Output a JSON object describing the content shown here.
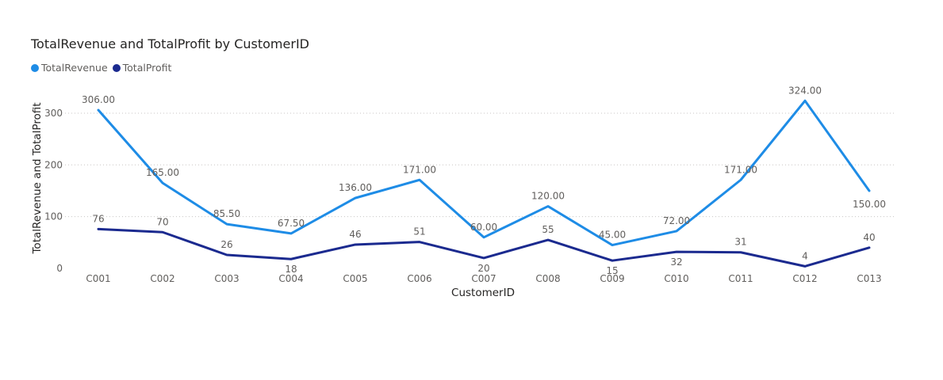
{
  "chart_data": {
    "type": "line",
    "title": "TotalRevenue and TotalProfit by CustomerID",
    "xlabel": "CustomerID",
    "ylabel": "TotalRevenue and TotalProfit",
    "ylim": [
      0,
      330
    ],
    "yticks": [
      0,
      100,
      200,
      300
    ],
    "grid": "horizontal dotted",
    "legend": "top-left",
    "categories": [
      "C001",
      "C002",
      "C003",
      "C004",
      "C005",
      "C006",
      "C007",
      "C008",
      "C009",
      "C010",
      "C011",
      "C012",
      "C013"
    ],
    "series": [
      {
        "name": "TotalRevenue",
        "color": "#1e8ce6",
        "values": [
          306,
          165,
          85.5,
          67.5,
          136,
          171,
          60,
          120,
          45,
          72,
          171,
          324,
          150
        ],
        "labels": [
          "306.00",
          "165.00",
          "85.50",
          "67.50",
          "136.00",
          "171.00",
          "60.00",
          "120.00",
          "45.00",
          "72.00",
          "171.00",
          "324.00",
          "150.00"
        ]
      },
      {
        "name": "TotalProfit",
        "color": "#1b2a8f",
        "values": [
          76,
          70,
          26,
          18,
          46,
          51,
          20,
          55,
          15,
          32,
          31,
          4,
          40
        ],
        "labels": [
          "76",
          "70",
          "26",
          "18",
          "46",
          "51",
          "20",
          "55",
          "15",
          "32",
          "31",
          "4",
          "40"
        ]
      }
    ]
  }
}
